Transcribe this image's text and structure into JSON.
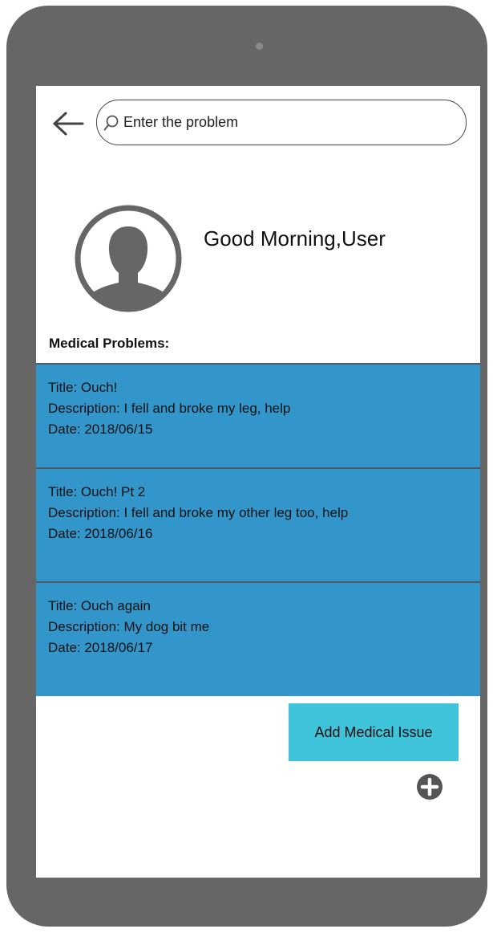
{
  "search": {
    "placeholder": "Enter the problem"
  },
  "header": {
    "back_icon": "arrow-left-icon",
    "search_icon": "search-icon"
  },
  "profile": {
    "avatar_icon": "user-avatar-icon",
    "greeting": "Good Morning,User"
  },
  "section": {
    "label": "Medical Problems:"
  },
  "problems": [
    {
      "title": "Title: Ouch!",
      "description": "Description: I fell and broke my leg, help",
      "date": "Date: 2018/06/15"
    },
    {
      "title": "Title: Ouch! Pt 2",
      "description": "Description: I fell and broke my other leg too, help",
      "date": "Date: 2018/06/16"
    },
    {
      "title": "Title: Ouch again",
      "description": "Description: My dog bit me",
      "date": "Date: 2018/06/17"
    }
  ],
  "actions": {
    "add_label": "Add Medical Issue",
    "add_icon": "plus-circle-icon"
  },
  "colors": {
    "device_frame": "#666666",
    "card_background": "#3396cb",
    "card_divider": "#4e5a63",
    "add_button": "#3ec3da",
    "plus_icon": "#555555"
  }
}
